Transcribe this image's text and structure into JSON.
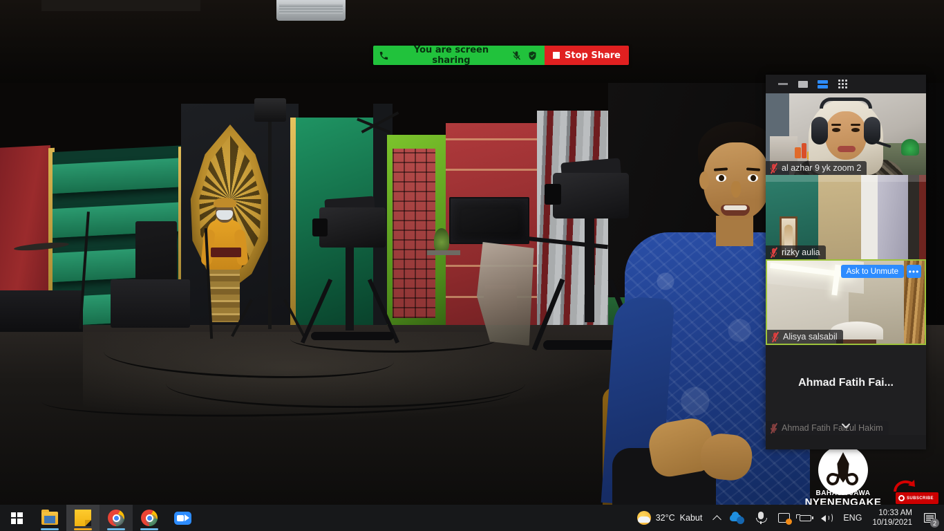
{
  "share_bar": {
    "phone_icon": "phone-icon",
    "status_text": "You are screen sharing",
    "mic_icon": "microphone-muted-icon",
    "shield_icon": "security-shield-icon",
    "stop_label": "Stop Share"
  },
  "zoom_panel": {
    "window_controls": [
      {
        "name": "minimize-button",
        "icon": "minimize-icon"
      },
      {
        "name": "maximize-button",
        "icon": "maximize-icon"
      },
      {
        "name": "speaker-view-button",
        "icon": "speaker-view-icon"
      },
      {
        "name": "gallery-view-button",
        "icon": "gallery-view-icon"
      }
    ],
    "accent_color": "#2d8cff",
    "active_speaker_border": "#9dc33b",
    "participants": [
      {
        "name": "al azhar 9 yk zoom 2",
        "muted": true,
        "video_on": true,
        "active_speaker": false
      },
      {
        "name": "rizky aulia",
        "muted": true,
        "video_on": true,
        "active_speaker": false
      },
      {
        "name": "Alisya salsabil",
        "muted": true,
        "video_on": true,
        "active_speaker": true,
        "ask_to_unmute_label": "Ask to Unmute",
        "more_label": "•••"
      },
      {
        "name": "Ahmad Fatih Faizul Hakim",
        "display_name": "Ahmad Fatih Fai...",
        "muted": true,
        "video_on": false,
        "active_speaker": false
      }
    ],
    "scroll_icon": "chevron-down-icon"
  },
  "watermark": {
    "line1": "BAHASA JAWA",
    "line2": "NYENENGAKE",
    "subscribe_label": "SUBSCRIBE"
  },
  "taskbar": {
    "items": [
      {
        "name": "start-button",
        "icon": "windows-logo-icon",
        "active": false,
        "running": false
      },
      {
        "name": "file-explorer-button",
        "icon": "folder-icon",
        "active": false,
        "running": true
      },
      {
        "name": "sticky-notes-button",
        "icon": "sticky-note-icon",
        "active": true,
        "running": true
      },
      {
        "name": "chrome-button-1",
        "icon": "chrome-icon",
        "active": false,
        "running": true
      },
      {
        "name": "chrome-button-2",
        "icon": "chrome-icon",
        "active": false,
        "running": true
      },
      {
        "name": "zoom-button",
        "icon": "zoom-camera-icon",
        "active": false,
        "running": false
      }
    ],
    "weather": {
      "temperature": "32°C",
      "condition": "Kabut"
    },
    "tray": [
      {
        "name": "show-hidden-icons",
        "icon": "chevron-up-icon"
      },
      {
        "name": "onedrive-icon",
        "icon": "onedrive-icon"
      },
      {
        "name": "microphone-icon",
        "icon": "microphone-icon"
      },
      {
        "name": "display-settings-icon",
        "icon": "display-icon"
      },
      {
        "name": "battery-icon",
        "icon": "battery-icon"
      },
      {
        "name": "volume-icon",
        "icon": "speaker-icon"
      }
    ],
    "language": "ENG",
    "time": "10:33 AM",
    "date": "10/19/2021",
    "notification_count": "2"
  }
}
